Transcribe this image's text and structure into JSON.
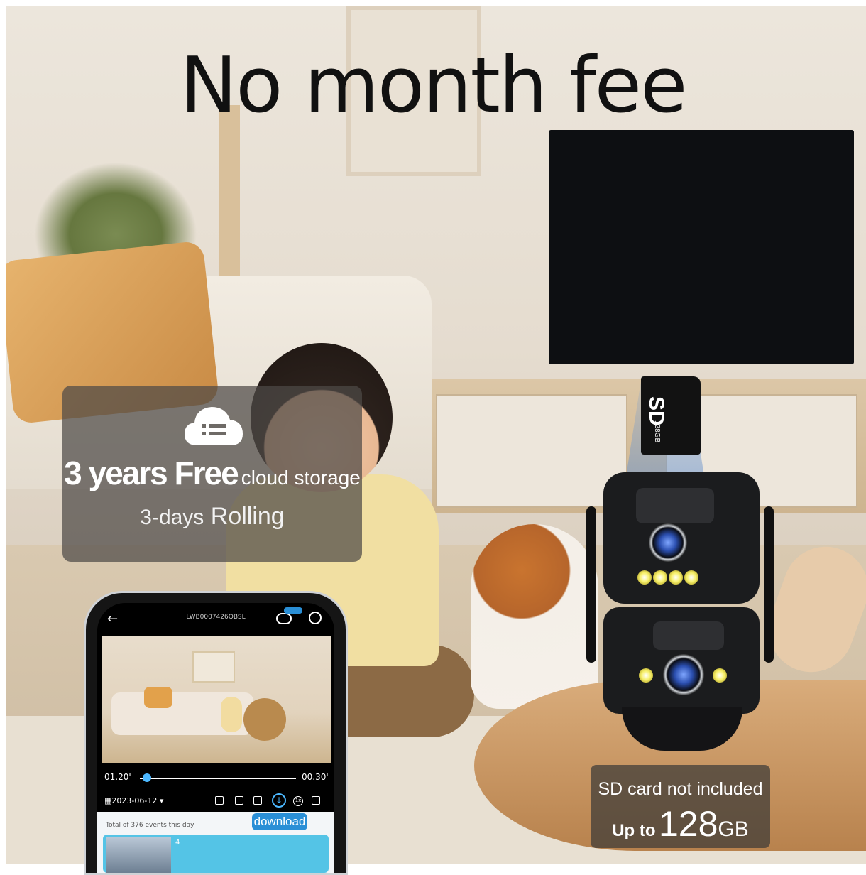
{
  "headline": "No month fee",
  "cloud_card": {
    "title_big": "3 years Free",
    "title_small": "cloud storage",
    "sub_small": "3-days",
    "sub_big": "Rolling"
  },
  "sd_card": {
    "label": "SD",
    "capacity_label": "128GB"
  },
  "sd_note": {
    "line1": "SD card not included",
    "up_to": "Up to",
    "number": "128",
    "unit": "GB"
  },
  "phone_app": {
    "device_id": "LWB0007426QBSL",
    "back_icon": "back-arrow-icon",
    "time_start": "01.20'",
    "time_end": "00.30'",
    "date": "2023-06-12",
    "total_events": "Total of 376 events this day",
    "download_label": "download",
    "event_number": "4",
    "speed": "1x",
    "accent_color": "#2a8fd6"
  }
}
